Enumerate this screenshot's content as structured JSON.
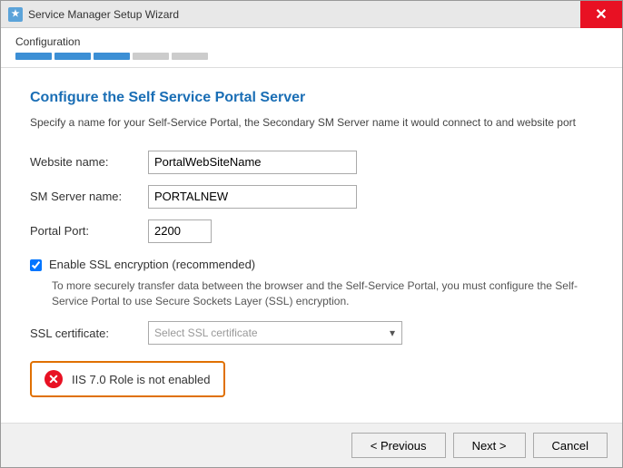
{
  "window": {
    "title": "Service Manager Setup Wizard",
    "icon": "★"
  },
  "progress": {
    "label": "Configuration",
    "steps": [
      "done",
      "done",
      "done",
      "inactive",
      "inactive"
    ]
  },
  "section": {
    "title": "Configure the Self Service Portal Server",
    "description": "Specify a name for your Self-Service Portal, the Secondary SM Server name it would connect to and website port"
  },
  "form": {
    "website_name_label": "Website name:",
    "website_name_value": "PortalWebSiteName",
    "sm_server_label": "SM Server name:",
    "sm_server_value": "PORTALNEW",
    "portal_port_label": "Portal Port:",
    "portal_port_value": "2200",
    "ssl_checkbox_label": "Enable SSL encryption (recommended)",
    "ssl_desc": "To more securely transfer data between the browser and the Self-Service Portal, you must configure the Self-Service Portal to use Secure Sockets Layer (SSL) encryption.",
    "ssl_cert_label": "SSL certificate:",
    "ssl_cert_placeholder": "Select SSL certificate"
  },
  "error": {
    "text": "IIS 7.0 Role is not enabled"
  },
  "footer": {
    "previous_label": "< Previous",
    "next_label": "Next >",
    "cancel_label": "Cancel"
  }
}
